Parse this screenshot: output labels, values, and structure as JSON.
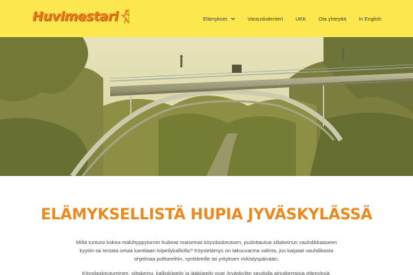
{
  "header": {
    "logo_text": "Huvimestari",
    "nav": [
      {
        "label": "Elämykset",
        "has_dropdown": true
      },
      {
        "label": "Varauskalenteri"
      },
      {
        "label": "UKK"
      },
      {
        "label": "Ota yhteyttä"
      },
      {
        "label": "In English"
      }
    ]
  },
  "main": {
    "title": "ELÄMYKSELLISTÄ HUPIA JYVÄSKYLÄSSÄ",
    "paragraph_1": "Miltä tuntuisi kokea mäkihyppytornin huikeat maisemat köysilaskeutuen, pudottautua siltakeinun vauhdikkaaseen kyytiin tai testata omaa kanttiaan kiipeilykalliolla? Köysielämys on takuuvarma valinta, jos kaipaat vauhdikasta ohjelmaa polttareihin, synttäreille tai yrityksen virkistyspäivään.",
    "paragraph_2": "Köysilaskeutuminen, siltakeinu, kalliokiipeily ja jääkiipeily ovat Jyväskylän seudulla ainutkertaisia elämyksiä."
  },
  "colors": {
    "header_bg": "#fde74f",
    "accent": "#e98a1f",
    "logo": "#e7781c"
  },
  "icons": [
    "climber-icon",
    "chevron-down-icon"
  ]
}
